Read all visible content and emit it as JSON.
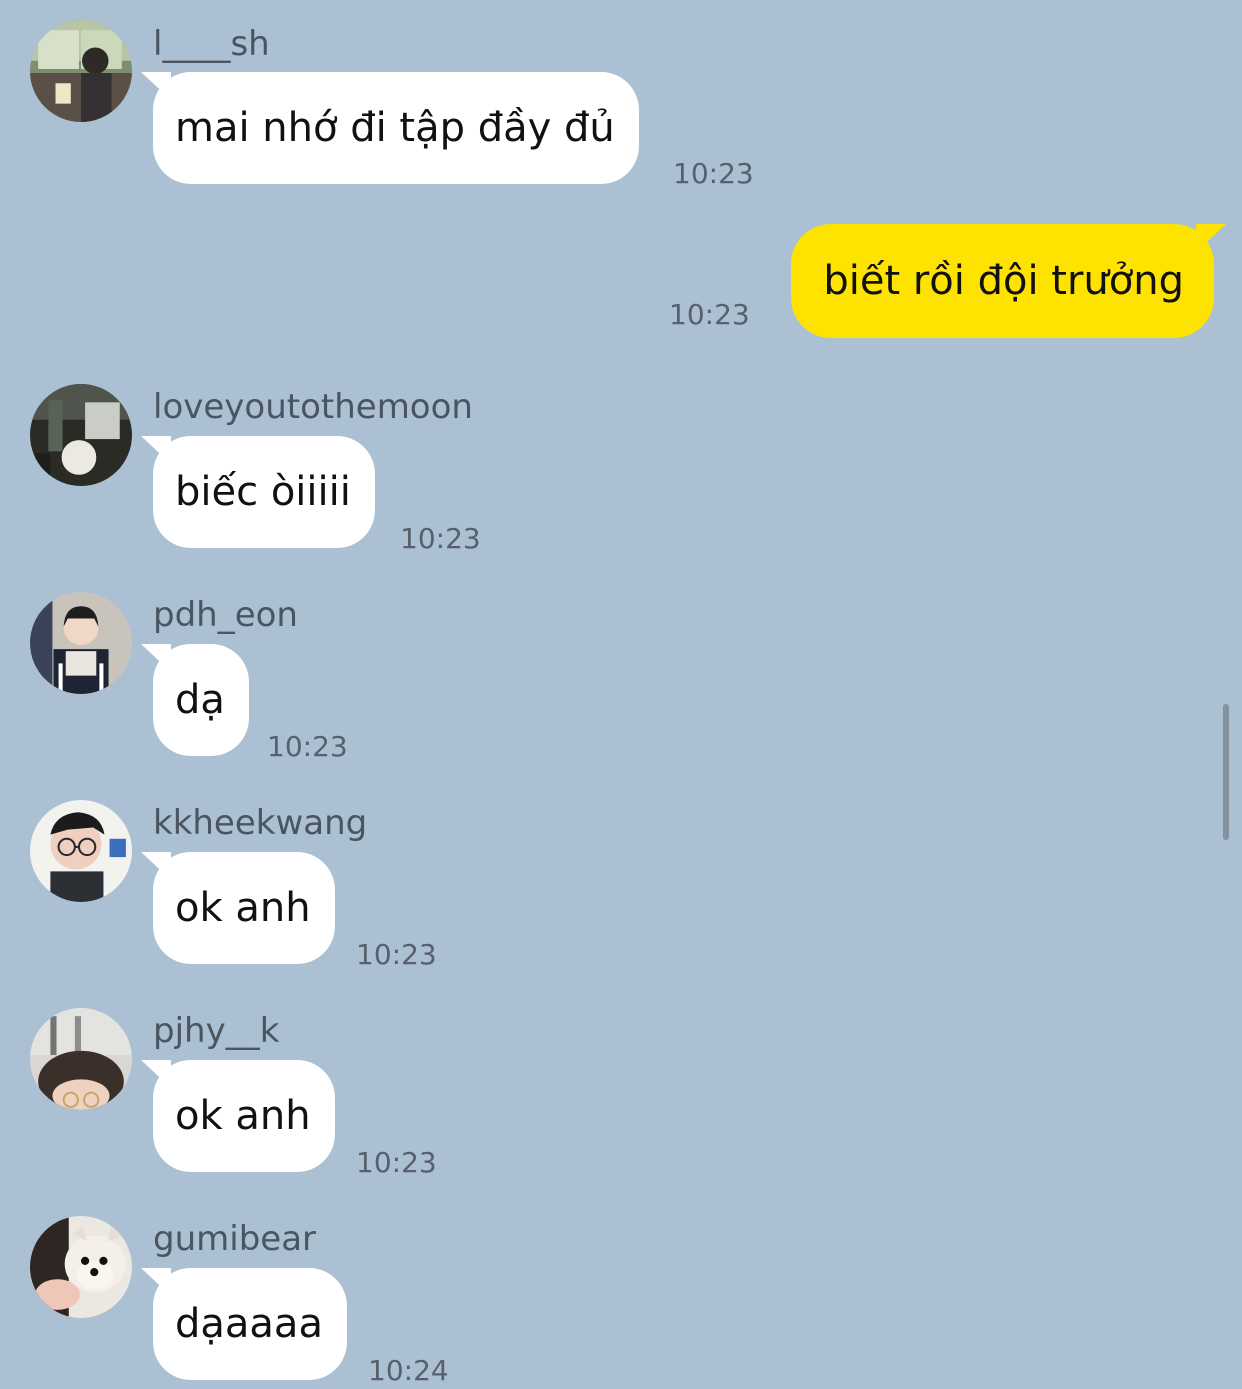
{
  "messages": {
    "m1": {
      "sender": "l____sh",
      "text": "mai nhớ đi tập đầy đủ",
      "time": "10:23"
    },
    "m2": {
      "text": "biết rồi đội trưởng",
      "time": "10:23"
    },
    "m3": {
      "sender": "loveyoutothemoon",
      "text": "biếc òiiiii",
      "time": "10:23"
    },
    "m4": {
      "sender": "pdh_eon",
      "text": "dạ",
      "time": "10:23"
    },
    "m5": {
      "sender": "kkheekwang",
      "text": "ok anh",
      "time": "10:23"
    },
    "m6": {
      "sender": "pjhy__k",
      "text": "ok anh",
      "time": "10:23"
    },
    "m7": {
      "sender": "gumibear",
      "text": "dạaaaa",
      "time": "10:24"
    }
  },
  "colors": {
    "background": "#abc1d3",
    "incoming_bubble": "#ffffff",
    "outgoing_bubble": "#ffe300",
    "sender_text": "#4b5560",
    "time_text": "#58616b"
  }
}
